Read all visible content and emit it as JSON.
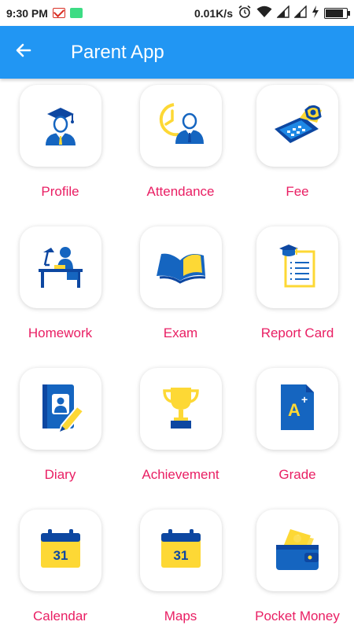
{
  "status_bar": {
    "time": "9:30 PM",
    "network_speed": "0.01K/s",
    "icons": [
      "gmail-icon",
      "android-icon",
      "alarm-icon",
      "wifi-icon",
      "signal-icon",
      "signal-icon",
      "charging-icon",
      "battery-icon"
    ]
  },
  "app_bar": {
    "back_icon": "arrow-left-icon",
    "title": "Parent App",
    "color": "#2196f3"
  },
  "menu": {
    "label_color": "#e91e63",
    "icon_blue": "#1565c0",
    "icon_yellow": "#fdd835",
    "items": [
      {
        "label": "Profile",
        "icon": "graduate-icon"
      },
      {
        "label": "Attendance",
        "icon": "attendance-clock-icon"
      },
      {
        "label": "Fee",
        "icon": "fee-calculator-icon"
      },
      {
        "label": "Homework",
        "icon": "homework-desk-icon"
      },
      {
        "label": "Exam",
        "icon": "open-book-icon"
      },
      {
        "label": "Report Card",
        "icon": "report-card-icon"
      },
      {
        "label": "Diary",
        "icon": "diary-icon"
      },
      {
        "label": "Achievement",
        "icon": "trophy-icon"
      },
      {
        "label": "Grade",
        "icon": "grade-icon"
      },
      {
        "label": "Calendar",
        "icon": "calendar-icon",
        "day": "31"
      },
      {
        "label": "Maps",
        "icon": "calendar-icon",
        "day": "31"
      },
      {
        "label": "Pocket Money",
        "icon": "wallet-icon"
      }
    ]
  }
}
